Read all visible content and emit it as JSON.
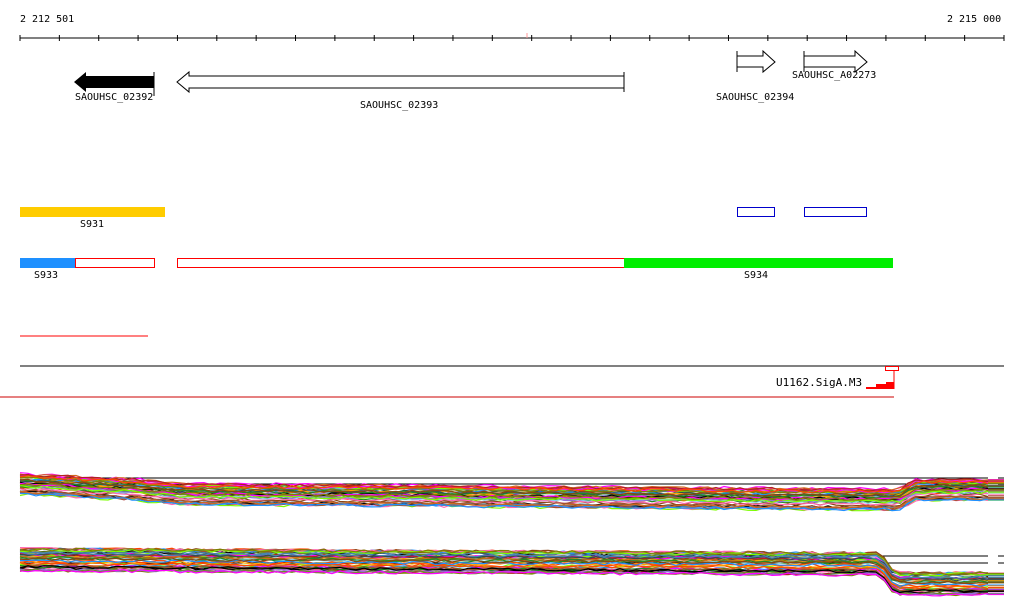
{
  "ruler": {
    "start_label": "2 212 501",
    "end_label": "2 215 000"
  },
  "genes": [
    {
      "name": "SAOUHSC_02392",
      "strand": "-",
      "filled": true
    },
    {
      "name": "SAOUHSC_02393",
      "strand": "-",
      "filled": false
    },
    {
      "name": "SAOUHSC_02394",
      "strand": "+",
      "filled": false
    },
    {
      "name": "SAOUHSC_A02273",
      "strand": "+",
      "filled": false
    }
  ],
  "segments": [
    {
      "name": "S931",
      "color": "#ffcc00"
    },
    {
      "name": "S933",
      "color": "#1e90ff"
    },
    {
      "name": "S934",
      "color": "#00ee00"
    }
  ],
  "promoter": {
    "label": "U1162.SigA.M3",
    "color": "#ff0000"
  },
  "colors": {
    "outline_red": "#ff0000",
    "outline_blue": "#0000cc"
  }
}
